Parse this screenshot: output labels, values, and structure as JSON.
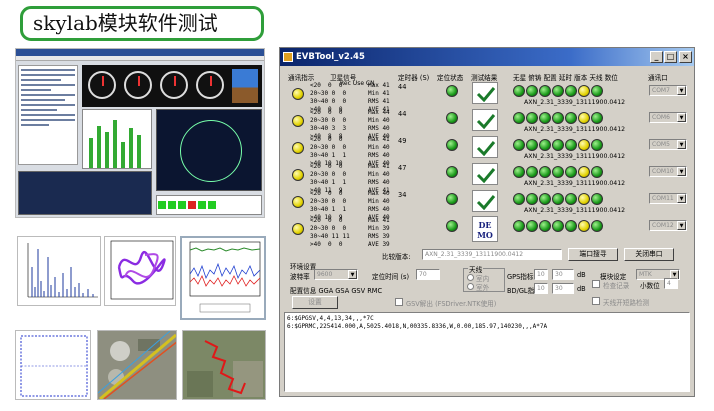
{
  "slide": {
    "title": "skylab模块软件测试"
  },
  "window": {
    "title": "EVBTool_v2.45",
    "min_glyph": "_",
    "max_glyph": "□",
    "close_glyph": "×"
  },
  "headers": {
    "comm": "通讯指示",
    "sat": "卫星信号",
    "sat_sub": "Rec Use CN",
    "timer": "定时器 (S)",
    "fix": "定位状态",
    "test": "测试结果",
    "flags": "无星 俯铸 配置 延时 版本 天线 数位",
    "port": "通讯口"
  },
  "rows": [
    {
      "sats": "<20  0  0\n20~30 0  0\n30~40 0  0\n>40  0  0",
      "snr": [
        "Max 41",
        "Min 41",
        "RMS 41",
        "AVE 41"
      ],
      "timer": "44",
      "ver": "AXN_2.31_3339_13111900.0412",
      "port": "COM7",
      "test": "check",
      "flags": [
        "g",
        "g",
        "g",
        "g",
        "g",
        "y",
        "g"
      ]
    },
    {
      "sats": "<20  0  0\n20~30 0  0\n30~40 3  3\n>40  8  8",
      "snr": [
        "Max 44",
        "Min 40",
        "RMS 40",
        "AVE 40"
      ],
      "timer": "44",
      "ver": "AXN_2.31_3339_13111900.0412",
      "port": "COM6",
      "test": "check",
      "flags": [
        "g",
        "g",
        "g",
        "g",
        "g",
        "y",
        "g"
      ]
    },
    {
      "sats": "<20  0  0\n20~30 0  0\n30~40 1  1\n>40 10 10",
      "snr": [
        "Max 41",
        "Min 40",
        "RMS 40",
        "AVE 40"
      ],
      "timer": "49",
      "ver": "AXN_2.31_3339_13111900.0412",
      "port": "COM5",
      "test": "check",
      "flags": [
        "g",
        "g",
        "g",
        "g",
        "g",
        "y",
        "g"
      ]
    },
    {
      "sats": "<20  0  0\n20~30 0  0\n30~40 1  1\n>40 11  9",
      "snr": [
        "Max 41",
        "Min 40",
        "RMS 40",
        "AVE 41"
      ],
      "timer": "47",
      "ver": "AXN_2.31_3339_13111900.0412",
      "port": "COM10",
      "test": "check",
      "flags": [
        "g",
        "g",
        "g",
        "g",
        "g",
        "y",
        "g"
      ]
    },
    {
      "sats": "<20  0  0\n20~30 0  0\n30~40 1  1\n>40 10  9",
      "snr": [
        "Max 40",
        "Min 40",
        "RMS 40",
        "AVE 40"
      ],
      "timer": "34",
      "ver": "AXN_2.31_3339_13111900.0412",
      "port": "COM11",
      "test": "check",
      "flags": [
        "g",
        "g",
        "g",
        "g",
        "g",
        "y",
        "g"
      ]
    },
    {
      "sats": "<20  0  0\n20~30 0  0\n30~40 11 11\n>40  0  0",
      "snr": [
        "Max 41",
        "Min 39",
        "RMS 39",
        "AVE 39"
      ],
      "timer": "",
      "ver": "",
      "port": "COM12",
      "test": "demo",
      "flags": [
        "g",
        "g",
        "g",
        "g",
        "g",
        "y",
        "g"
      ]
    }
  ],
  "demo": "DE\nMO",
  "compare": {
    "label": "比较版本:",
    "value": "AXN_2.31_3339_13111900.0412",
    "search_button": "端口搜寻",
    "close_button": "关闭串口"
  },
  "env": {
    "group_label": "环境设置",
    "baud_label": "波特率",
    "baud_value": "9600",
    "fix_time_label": "定位时间 (s)",
    "fix_time_value": "70",
    "antenna_label": "天线",
    "antenna_in": "室内",
    "antenna_out": "室外",
    "gps_label": "GPS指标",
    "gps_a": "10",
    "gps_b": "30",
    "gps_unit": "dB",
    "mode_label": "模块设定",
    "mode_value": "MTK",
    "config_label": "配置信息 GGA GSA GSV RMC",
    "bd_label": "BD/GL指标",
    "bd_a": "10",
    "bd_b": "30",
    "bd_unit": "dB",
    "save_log": "检查记录",
    "decimal_label": "小数位",
    "decimal_value": "4",
    "settings_button": "设置",
    "usb_check": "GSV解出 (FSDriver.NTK使用)",
    "antenna_check": "天线开短路检测"
  },
  "nmea": [
    "6:$GPGSV,4,4,13,34,,,*7C",
    "6:$GPRMC,225414.000,A,5025.4018,N,00335.8336,W,0.00,185.97,140230,,,A*7A"
  ]
}
